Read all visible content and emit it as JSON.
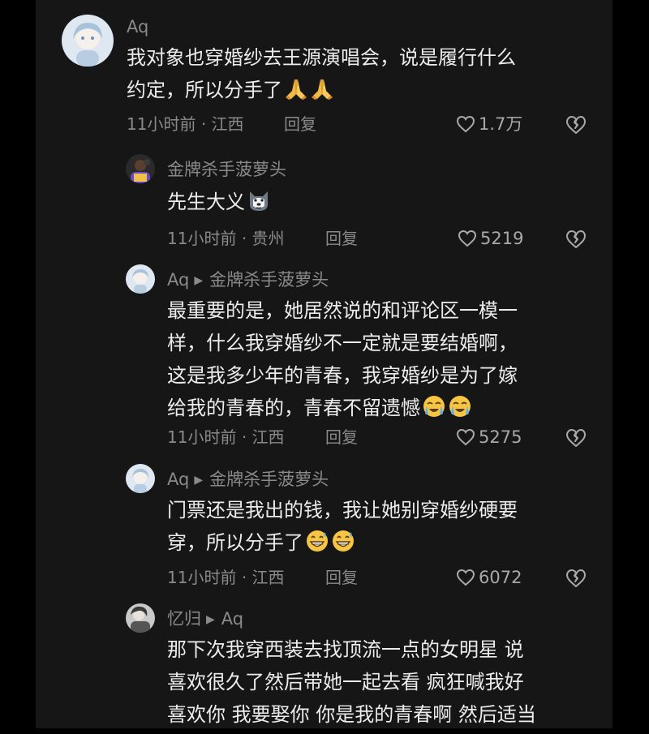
{
  "comments": [
    {
      "username": "Aq",
      "lines": [
        "我对象也穿婚纱去王源演唱会，说是履行什么",
        "约定，所以分手了"
      ],
      "emoji": [
        "pray-emoji",
        "pray-emoji"
      ],
      "time": "11小时前",
      "location": "江西",
      "reply_label": "回复",
      "likes": "1.7万"
    },
    {
      "username": "金牌杀手菠萝头",
      "lines": [
        "先生大义"
      ],
      "emoji": [
        "husky-emoji"
      ],
      "time": "11小时前",
      "location": "贵州",
      "reply_label": "回复",
      "likes": "5219"
    },
    {
      "username": "Aq",
      "reply_to": "金牌杀手菠萝头",
      "lines": [
        "最重要的是，她居然说的和评论区一模一",
        "样，什么我穿婚纱不一定就是要结婚啊，",
        "这是我多少年的青春，我穿婚纱是为了嫁",
        "给我的青春的，青春不留遗憾"
      ],
      "emoji": [
        "crying-emoji",
        "crying-emoji"
      ],
      "time": "11小时前",
      "location": "江西",
      "reply_label": "回复",
      "likes": "5275"
    },
    {
      "username": "Aq",
      "reply_to": "金牌杀手菠萝头",
      "lines": [
        "门票还是我出的钱，我让她别穿婚纱硬要",
        "穿，所以分手了"
      ],
      "emoji": [
        "grin-sweat-emoji",
        "grin-sweat-emoji"
      ],
      "time": "11小时前",
      "location": "江西",
      "reply_label": "回复",
      "likes": "6072"
    },
    {
      "username": "忆归",
      "reply_to": "Aq",
      "lines": [
        "那下次我穿西装去找顶流一点的女明星 说",
        "喜欢很久了然后带她一起去看 疯狂喊我好",
        "喜欢你 我要娶你 你是我的青春啊 然后适当"
      ]
    }
  ],
  "meta_separator": "·",
  "colors": {
    "background": "#161616",
    "text": "#ececec",
    "secondary": "#8a8a8a"
  }
}
